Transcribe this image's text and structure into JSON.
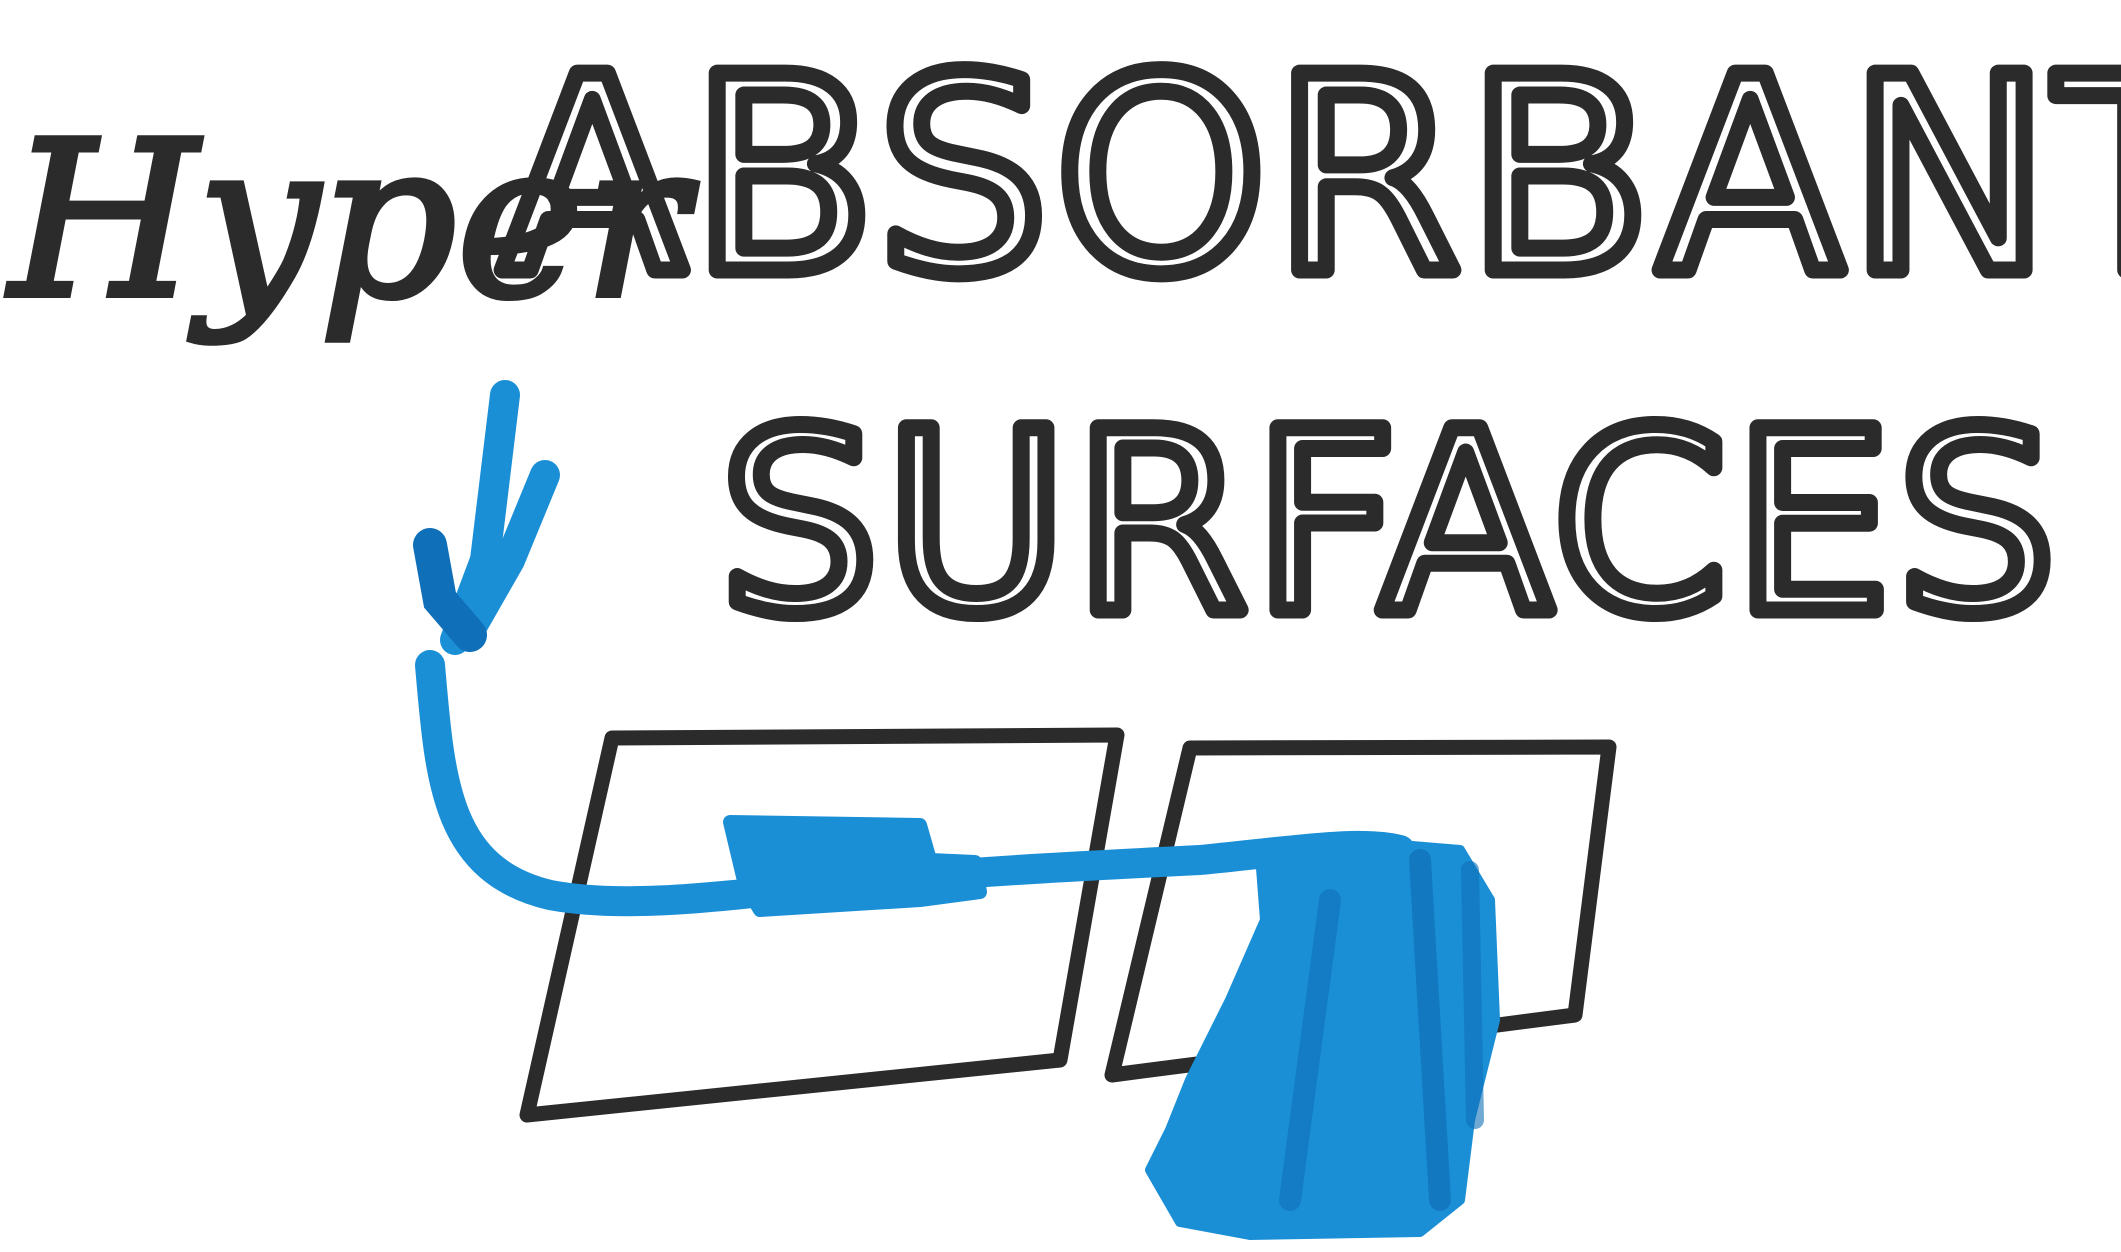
{
  "title": {
    "line1_prefix": "Hyper",
    "line1_main": "ABSORBANT",
    "line2": "SURFACES"
  },
  "colors": {
    "ink": "#2b2b2b",
    "marker_blue": "#1a8fd6",
    "marker_blue_dark": "#0f6fb8",
    "background": "#ffffff"
  }
}
